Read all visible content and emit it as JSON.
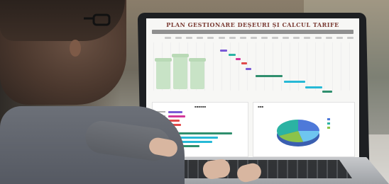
{
  "spreadsheet": {
    "title": "PLAN GESTIONARE DEȘEURI ȘI CALCUL TARIFE"
  },
  "colors": {
    "title": "#7a3b33",
    "gantt_purple": "#7b5bd6",
    "gantt_magenta": "#d2379a",
    "gantt_red": "#e14b4b",
    "gantt_green": "#2f8f6e",
    "gantt_cyan": "#27b9d6",
    "pie_blue": "#4e79d9",
    "pie_teal": "#2bb3a3",
    "pie_green": "#8bc34a",
    "pie_lightblue": "#6ec6f0",
    "bins_green": "#c8e3c6"
  },
  "icons": [
    "recycling-bins-illustration"
  ]
}
